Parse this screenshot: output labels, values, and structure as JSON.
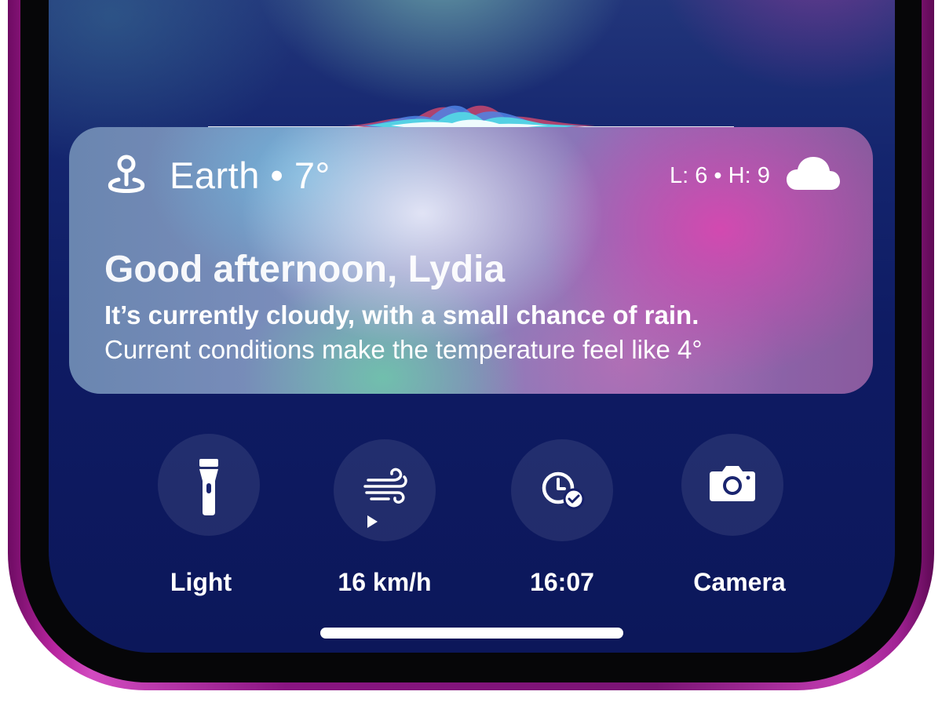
{
  "widget": {
    "location": "Earth • 7°",
    "low_high": "L: 6 • H: 9",
    "greeting": "Good afternoon, Lydia",
    "condition": "It’s currently cloudy, with a small chance of rain.",
    "feels_like": "Current conditions make the temperature feel like 4°",
    "icons": {
      "location": "map-pin-icon",
      "weather": "cloud-icon"
    }
  },
  "quick_actions": [
    {
      "label": "Light",
      "icon": "flashlight-icon"
    },
    {
      "label": "16 km/h",
      "icon": "wind-icon"
    },
    {
      "label": "16:07",
      "icon": "clock-check-icon"
    },
    {
      "label": "Camera",
      "icon": "camera-icon"
    }
  ],
  "colors": {
    "frame_accent": "#b8259f",
    "screen_background": "#0e1b63",
    "text": "#ffffff"
  }
}
